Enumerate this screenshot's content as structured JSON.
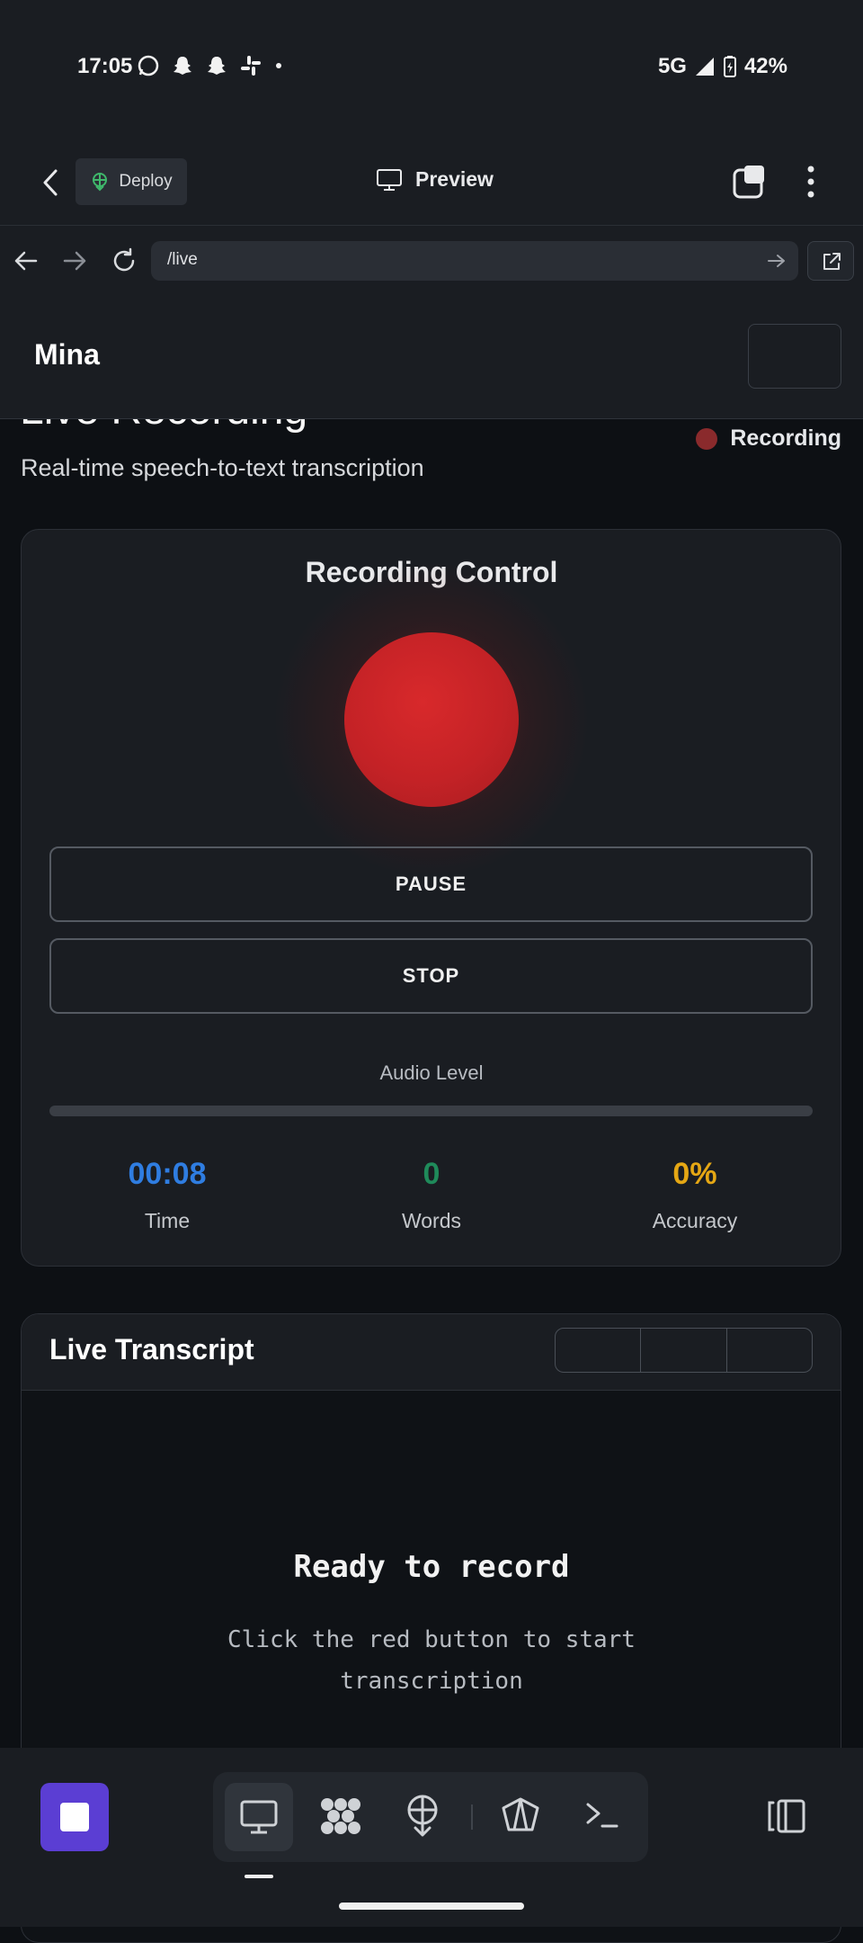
{
  "status_bar": {
    "time": "17:05",
    "network": "5G",
    "battery": "42%"
  },
  "toolbar": {
    "deploy_label": "Deploy",
    "preview_label": "Preview"
  },
  "browser": {
    "url": "/live"
  },
  "app": {
    "title": "Mina"
  },
  "page": {
    "heading": "Live Recording",
    "subtitle": "Real-time speech-to-text transcription",
    "status_label": "Recording"
  },
  "recording_control": {
    "title": "Recording Control",
    "pause_label": "PAUSE",
    "stop_label": "STOP",
    "audio_level_label": "Audio Level",
    "audio_level": 0,
    "stats": [
      {
        "value": "00:08",
        "label": "Time",
        "color": "#2f7de1"
      },
      {
        "value": "0",
        "label": "Words",
        "color": "#1f8a5a"
      },
      {
        "value": "0%",
        "label": "Accuracy",
        "color": "#e5a714"
      }
    ]
  },
  "transcript": {
    "title": "Live Transcript",
    "empty_title": "Ready to record",
    "empty_hint": "Click the red button to start transcription"
  },
  "colors": {
    "accent": "#5b3ed3",
    "record": "#c42226"
  }
}
